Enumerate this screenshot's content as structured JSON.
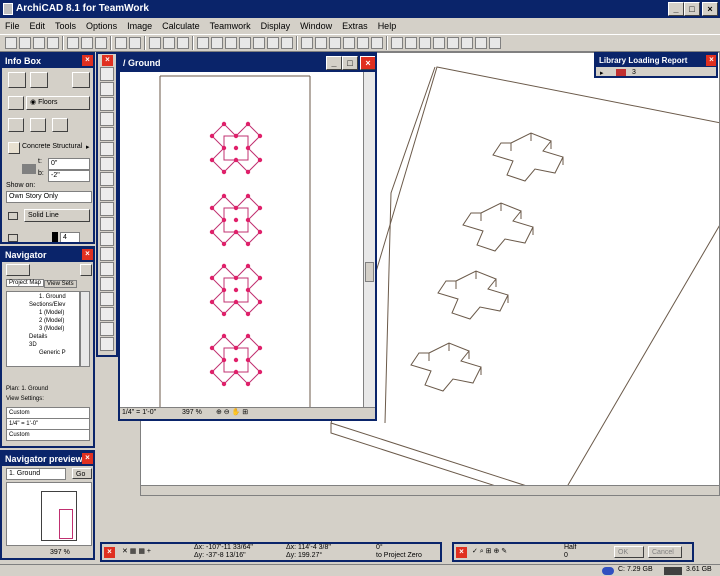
{
  "app": {
    "title": "ArchiCAD 8.1 for TeamWork"
  },
  "menu": [
    "File",
    "Edit",
    "Tools",
    "Options",
    "Image",
    "Calculate",
    "Teamwork",
    "Display",
    "Window",
    "Extras",
    "Help"
  ],
  "infobox": {
    "title": "Info Box",
    "floors": "Floors",
    "material": "Concrete Structural",
    "top_label": "t:",
    "top_val": "0\"",
    "bottom_label": "b:",
    "bottom_val": "-2\"",
    "show_on": "Show on:",
    "show_on_val": "Own Story Only",
    "line_type": "Solid Line",
    "pen": "4"
  },
  "navigator": {
    "title": "Navigator",
    "tab1": "Project Map",
    "tab2": "View Sets",
    "tree": [
      "1. Ground",
      "Sections/Elev",
      "1 (Model)",
      "2 (Model)",
      "3 (Model)",
      "Details",
      "3D",
      "Generic P"
    ],
    "plan": "Plan: 1. Ground",
    "view_settings": "View Settings:",
    "custom1": "Custom",
    "scale": "1/4\"  =  1'-0\"",
    "custom2": "Custom"
  },
  "nav_preview": {
    "title": "Navigator preview",
    "story": "1. Ground",
    "go": "Go",
    "zoom": "397 %"
  },
  "plan_window": {
    "title": "/ Ground",
    "scale": "1/4\"  =  1'-0\"",
    "zoom": "397 %"
  },
  "library_report": {
    "title": "Library Loading Report",
    "count": "3"
  },
  "coords": {
    "ax_label": "Δx:",
    "ax": "-107'-11 33/64\"",
    "ay_label": "Δy:",
    "ay": "-37'-8 13/16\"",
    "bx_label": "Δx:",
    "bx": "114'-4 3/8\"",
    "by_label": "Δy:",
    "by": "199.27°",
    "angle": "0°",
    "ref": "to Project Zero"
  },
  "control": {
    "half": "Half",
    "zero": "0",
    "ok": "OK",
    "cancel": "Cancel"
  },
  "statusbar": {
    "disk_c": "C: 7.29 GB",
    "ram": "3.61 GB"
  },
  "colors": {
    "titlebar": "#0a246a",
    "hotspot": "#e0206a",
    "lines": "#6b5a4a"
  }
}
